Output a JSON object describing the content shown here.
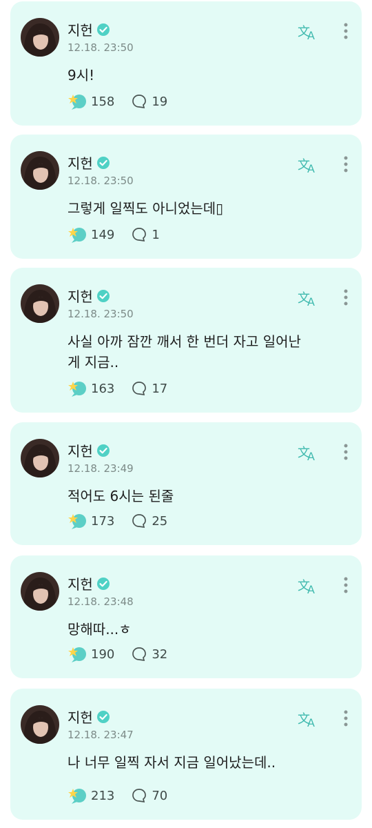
{
  "posts": [
    {
      "name": "지헌",
      "time": "12.18. 23:50",
      "text": "9시!",
      "likes": "158",
      "comments": "19"
    },
    {
      "name": "지헌",
      "time": "12.18. 23:50",
      "text": "그렇게 일찍도 아니었는데▯",
      "likes": "149",
      "comments": "1"
    },
    {
      "name": "지헌",
      "time": "12.18. 23:50",
      "text": "사실 아까 잠깐 깨서 한 번더 자고 일어난\n게 지금..",
      "likes": "163",
      "comments": "17"
    },
    {
      "name": "지헌",
      "time": "12.18. 23:49",
      "text": "적어도 6시는 된줄",
      "likes": "173",
      "comments": "25"
    },
    {
      "name": "지헌",
      "time": "12.18. 23:48",
      "text": "망해따...ㅎ",
      "likes": "190",
      "comments": "32"
    },
    {
      "name": "지헌",
      "time": "12.18. 23:47",
      "text": "나 너무 일찍 자서 지금 일어났는데..",
      "likes": "213",
      "comments": "70"
    }
  ],
  "icons": {
    "verified": "verified-badge-icon",
    "translate": "translate-icon",
    "more": "more-vertical-icon",
    "like": "like-bubble-icon",
    "comment": "comment-icon"
  },
  "colors": {
    "card_bg": "#e3fbf6",
    "accent": "#4fd1c5"
  }
}
